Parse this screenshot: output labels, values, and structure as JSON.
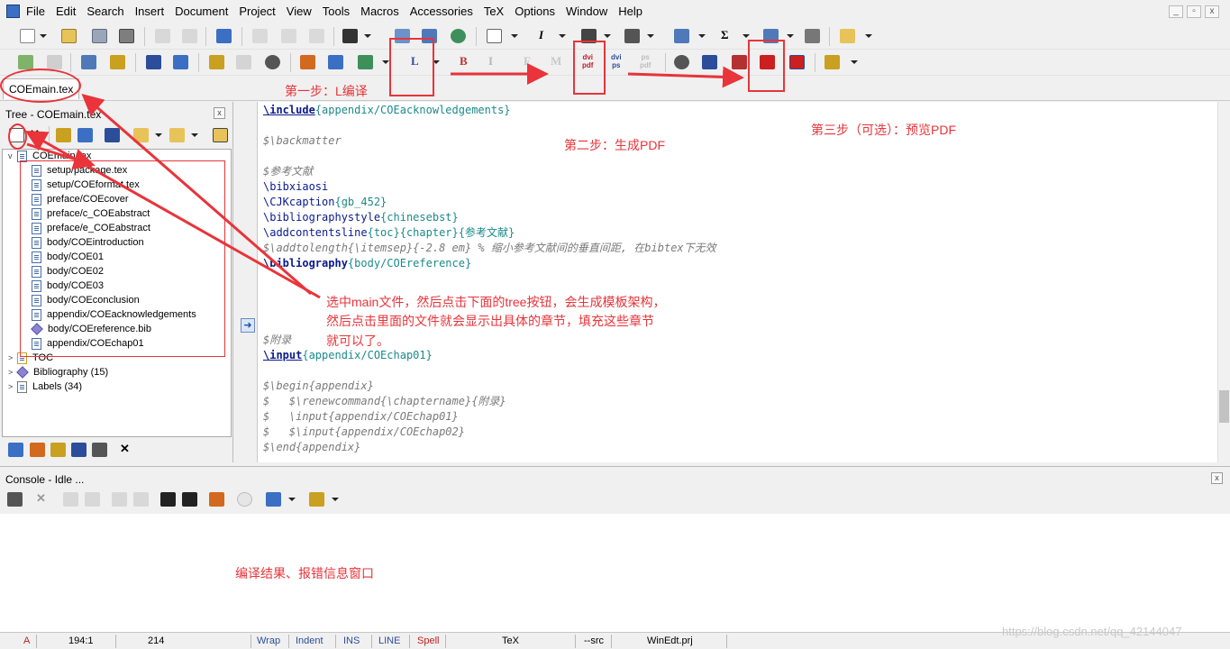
{
  "menu": [
    "File",
    "Edit",
    "Search",
    "Insert",
    "Document",
    "Project",
    "View",
    "Tools",
    "Macros",
    "Accessories",
    "TeX",
    "Options",
    "Window",
    "Help"
  ],
  "window_controls": [
    "_",
    "▫",
    "x"
  ],
  "toolbar2_letters": {
    "latex": "L",
    "bold": "B",
    "italic": "I",
    "f": "F",
    "m": "M"
  },
  "toolbar2_small": {
    "dvipdf": "dvi\npdf",
    "dvips": "dvi\nps",
    "pspdf": "ps\npdf"
  },
  "tab": {
    "label": "COEmain.tex"
  },
  "tree": {
    "title": "Tree - COEmain.tex",
    "close": "x",
    "root": "COEmain.tex",
    "files": [
      {
        "name": "setup/package.tex",
        "type": "file"
      },
      {
        "name": "setup/COEformat.tex",
        "type": "file"
      },
      {
        "name": "preface/COEcover",
        "type": "file"
      },
      {
        "name": "preface/c_COEabstract",
        "type": "file"
      },
      {
        "name": "preface/e_COEabstract",
        "type": "file"
      },
      {
        "name": "body/COEintroduction",
        "type": "file"
      },
      {
        "name": "body/COE01",
        "type": "file"
      },
      {
        "name": "body/COE02",
        "type": "file"
      },
      {
        "name": "body/COE03",
        "type": "file"
      },
      {
        "name": "body/COEconclusion",
        "type": "file"
      },
      {
        "name": "appendix/COEacknowledgements",
        "type": "file"
      },
      {
        "name": "body/COEreference.bib",
        "type": "bib"
      },
      {
        "name": "appendix/COEchap01",
        "type": "file"
      }
    ],
    "toc": "TOC",
    "bibliography": "Bibliography  (15)",
    "labels": "Labels  (34)"
  },
  "editor": {
    "lines": [
      {
        "cmd": "\\include",
        "arg": "{appendix/COEacknowledgements}",
        "style": "kwu"
      },
      {
        "text": "",
        "style": "blk"
      },
      {
        "text": "$\\backmatter",
        "style": "cmt"
      },
      {
        "text": "",
        "style": "blk"
      },
      {
        "text": "$参考文献",
        "style": "cmt"
      },
      {
        "cmd": "\\bibxiaosi",
        "arg": "",
        "style": "kw"
      },
      {
        "cmd": "\\CJKcaption",
        "arg": "{gb_452}",
        "style": "kw"
      },
      {
        "cmd": "\\bibliographystyle",
        "arg": "{chinesebst}",
        "style": "kw"
      },
      {
        "cmd": "\\addcontentsline",
        "arg": "{toc}{chapter}{参考文献}",
        "style": "kw"
      },
      {
        "text": "$\\addtolength{\\itemsep}{-2.8 em} % 缩小参考文献间的垂直间距, 在bibtex下无效",
        "style": "cmt"
      },
      {
        "cmd": "\\bibliography",
        "arg": "{body/COEreference}",
        "style": "kwb"
      },
      {
        "text": "",
        "style": "blk"
      },
      {
        "text": "",
        "style": "blk"
      },
      {
        "text": "",
        "style": "blk"
      },
      {
        "text": "",
        "style": "blk"
      },
      {
        "text": "$附录",
        "style": "cmt"
      },
      {
        "cmd": "\\input",
        "arg": "{appendix/COEchap01}",
        "style": "kwu"
      },
      {
        "text": "",
        "style": "blk"
      },
      {
        "text": "$\\begin{appendix}",
        "style": "cmt"
      },
      {
        "text": "$   $\\renewcommand{\\chaptername}{附录}",
        "style": "cmt"
      },
      {
        "text": "$   \\input{appendix/COEchap01}",
        "style": "cmt"
      },
      {
        "text": "$   $\\input{appendix/COEchap02}",
        "style": "cmt"
      },
      {
        "text": "$\\end{appendix}",
        "style": "cmt"
      }
    ]
  },
  "console": {
    "title": "Console - Idle ...",
    "close": "x"
  },
  "statusbar": {
    "a": "A",
    "position": "194:1",
    "count": "214",
    "wrap": "Wrap",
    "indent": "Indent",
    "ins": "INS",
    "line": "LINE",
    "spell": "Spell",
    "tex": "TeX",
    "src": "--src",
    "project": "WinEdt.prj"
  },
  "annotations": {
    "step1": "第一步：L编译",
    "step2": "第二步：生成PDF",
    "step3": "第三步（可选）：预览PDF",
    "tree_note_1": "选中main文件，然后点击下面的tree按钮，会生成模板架构，",
    "tree_note_2": "然后点击里面的文件就会显示出具体的章节，填充这些章节",
    "tree_note_3": "就可以了。",
    "console_note": "编译结果、报错信息窗口"
  },
  "watermark": "https://blog.csdn.net/qq_42144047",
  "colors": {
    "annotation": "#e8343a",
    "keyword": "#0a1a8c",
    "argument": "#1c8a8a",
    "comment": "#7a7a7a"
  }
}
